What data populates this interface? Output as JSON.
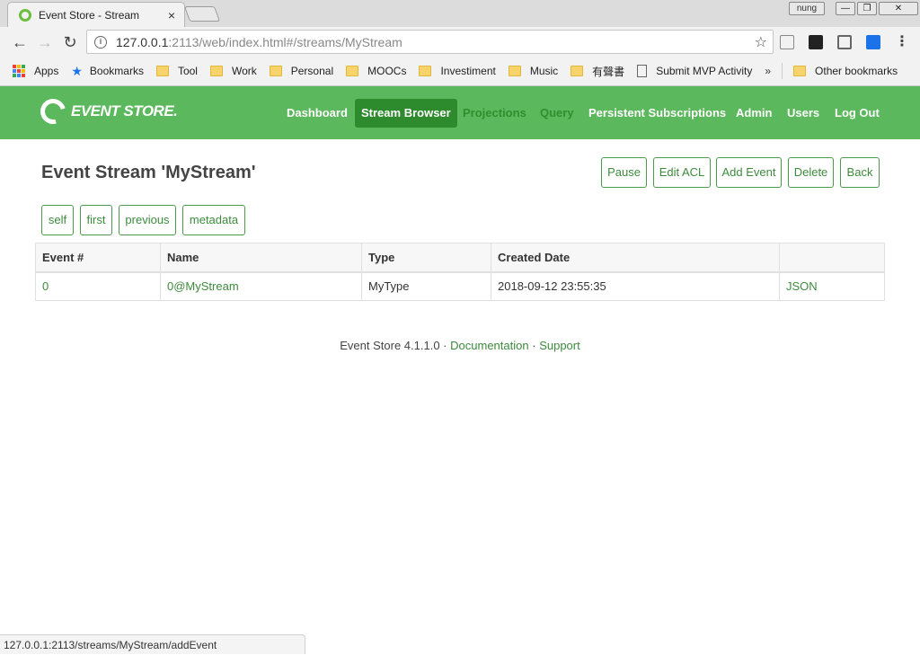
{
  "browser": {
    "tab_title": "Event Store - Stream",
    "tab_close": "×",
    "profile": "nung",
    "window_buttons": {
      "minimize": "—",
      "restore": "❐",
      "close": "✕"
    },
    "back": "←",
    "forward": "→",
    "reload": "↻",
    "url_host": "127.0.0.1",
    "url_rest": ":2113/web/index.html#/streams/MyStream",
    "star": "☆",
    "menu": "⋮",
    "bookmarks": [
      {
        "label": "Apps",
        "icon": "apps-grid-icon"
      },
      {
        "label": "Bookmarks",
        "icon": "star-icon"
      },
      {
        "label": "Tool",
        "icon": "folder-icon"
      },
      {
        "label": "Work",
        "icon": "folder-icon"
      },
      {
        "label": "Personal",
        "icon": "folder-icon"
      },
      {
        "label": "MOOCs",
        "icon": "folder-icon"
      },
      {
        "label": "Investiment",
        "icon": "folder-icon"
      },
      {
        "label": "Music",
        "icon": "folder-icon"
      },
      {
        "label": "有聲書",
        "icon": "folder-icon"
      },
      {
        "label": "Submit MVP Activity",
        "icon": "page-icon"
      }
    ],
    "overflow": "»",
    "other_bookmarks": "Other bookmarks",
    "status_url": "127.0.0.1:2113/streams/MyStream/addEvent"
  },
  "app": {
    "logo_text": "EVENT STORE.",
    "nav": [
      {
        "label": "Dashboard",
        "state": "normal"
      },
      {
        "label": "Stream Browser",
        "state": "active"
      },
      {
        "label": "Projections",
        "state": "muted"
      },
      {
        "label": "Query",
        "state": "muted"
      },
      {
        "label": "Persistent Subscriptions",
        "state": "normal"
      },
      {
        "label": "Admin",
        "state": "normal"
      },
      {
        "label": "Users",
        "state": "normal"
      },
      {
        "label": "Log Out",
        "state": "normal"
      }
    ],
    "accent_color": "#5cb85c"
  },
  "page": {
    "title": "Event Stream 'MyStream'",
    "actions": [
      "Pause",
      "Edit ACL",
      "Add Event",
      "Delete",
      "Back"
    ],
    "pager": [
      "self",
      "first",
      "previous",
      "metadata"
    ],
    "table": {
      "headers": [
        "Event #",
        "Name",
        "Type",
        "Created Date",
        ""
      ],
      "rows": [
        {
          "event_no": "0",
          "name": "0@MyStream",
          "type": "MyType",
          "created": "2018-09-12 23:55:35",
          "action": "JSON"
        }
      ]
    },
    "footer": {
      "version": "Event Store 4.1.1.0",
      "sep": "·",
      "documentation": "Documentation",
      "support": "Support"
    }
  }
}
